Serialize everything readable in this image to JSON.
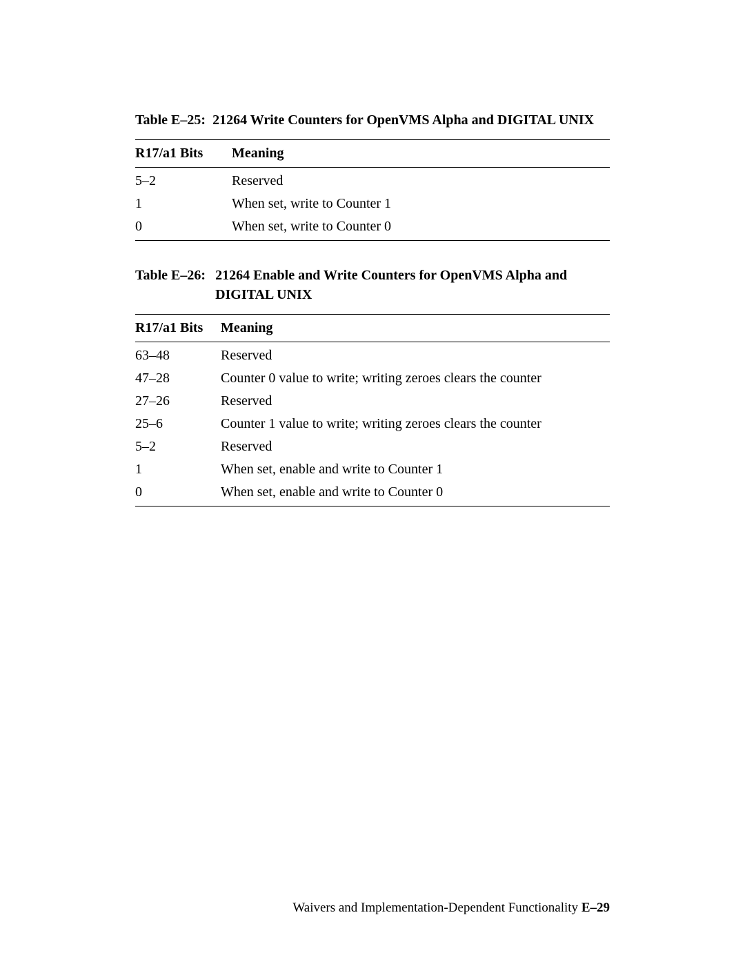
{
  "table1": {
    "label": "Table E–25:",
    "title": "21264 Write Counters for OpenVMS Alpha and DIGITAL UNIX",
    "header_bits": "R17/a1 Bits",
    "header_meaning": "Meaning",
    "rows": [
      {
        "bits": "5–2",
        "meaning": "Reserved"
      },
      {
        "bits": "1",
        "meaning": "When set, write to Counter 1"
      },
      {
        "bits": "0",
        "meaning": "When set, write to Counter 0"
      }
    ]
  },
  "table2": {
    "label": "Table E–26:",
    "title": "21264 Enable and Write Counters for OpenVMS Alpha and DIGITAL UNIX",
    "header_bits": "R17/a1 Bits",
    "header_meaning": "Meaning",
    "rows": [
      {
        "bits": "63–48",
        "meaning": "Reserved"
      },
      {
        "bits": "47–28",
        "meaning": "Counter 0 value to write; writing zeroes clears the counter"
      },
      {
        "bits": "27–26",
        "meaning": "Reserved"
      },
      {
        "bits": "25–6",
        "meaning": "Counter 1 value to write; writing zeroes clears the counter"
      },
      {
        "bits": "5–2",
        "meaning": "Reserved"
      },
      {
        "bits": "1",
        "meaning": "When set,  enable and write to Counter 1"
      },
      {
        "bits": "0",
        "meaning": "When set,  enable and write to Counter 0"
      }
    ]
  },
  "footer": {
    "text": "Waivers and Implementation-Dependent Functionality ",
    "page": "E–29"
  }
}
